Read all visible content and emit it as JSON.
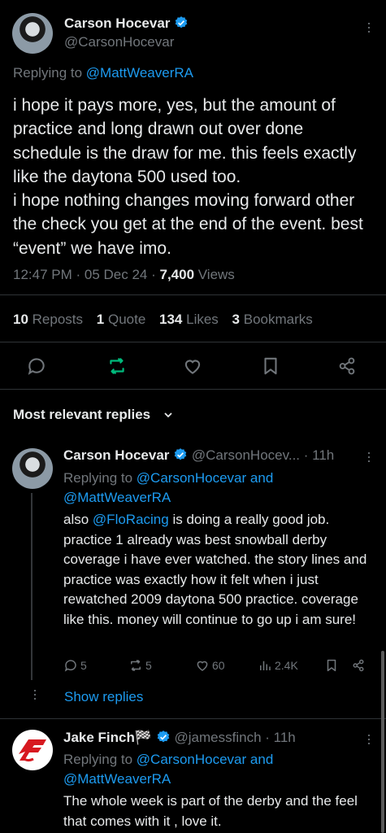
{
  "main_tweet": {
    "author_name": "Carson Hocevar",
    "author_handle": "@CarsonHocevar",
    "replying_prefix": "Replying to",
    "replying_to": "@MattWeaverRA",
    "text": "i hope it pays more, yes, but the amount of practice and long drawn out over done schedule is the draw for me. this feels exactly like the daytona 500 used too.\ni hope nothing changes moving forward other the check you get at the end of the event. best “event” we have imo.",
    "time": "12:47 PM",
    "date": "05 Dec 24",
    "views_count": "7,400",
    "views_label": "Views",
    "stats": {
      "reposts_count": "10",
      "reposts_label": "Reposts",
      "quotes_count": "1",
      "quotes_label": "Quote",
      "likes_count": "134",
      "likes_label": "Likes",
      "bookmarks_count": "3",
      "bookmarks_label": "Bookmarks"
    }
  },
  "replies_sort": "Most relevant replies",
  "reply_1": {
    "author_name": "Carson Hocevar",
    "author_handle": "@CarsonHocev...",
    "age": "· 11h",
    "replying_prefix": "Replying to",
    "replying_to_1": "@CarsonHocevar",
    "replying_and": "and",
    "replying_to_2": "@MattWeaverRA",
    "text_prefix": "also ",
    "text_mention": "@FloRacing",
    "text_rest": " is doing a really good job. practice 1 already was best snowball derby coverage i have ever watched. the story lines and practice was exactly how it felt when i just rewatched 2009 daytona 500 practice. coverage like this. money will continue to go up i am sure!",
    "replies": "5",
    "reposts": "5",
    "likes": "60",
    "views": "2.4K",
    "show_replies": "Show replies"
  },
  "reply_2": {
    "author_name": "Jake Finch",
    "author_flag": "🏁",
    "author_handle": "@jamessfinch",
    "age": "· 11h",
    "replying_prefix": "Replying to",
    "replying_to_1": "@CarsonHocevar",
    "replying_and": "and",
    "replying_to_2": "@MattWeaverRA",
    "text": "The whole week is part of the derby and the feel that comes with it , love it."
  },
  "colors": {
    "accent": "#1d9bf0",
    "repost_active": "#00ba7c",
    "muted": "#71767b",
    "text": "#e7e9ea",
    "background": "#000000"
  },
  "icons": [
    "verified-badge-icon",
    "more-icon",
    "reply-icon",
    "repost-icon",
    "like-icon",
    "bookmark-icon",
    "share-icon",
    "chevron-down-icon",
    "views-icon"
  ]
}
